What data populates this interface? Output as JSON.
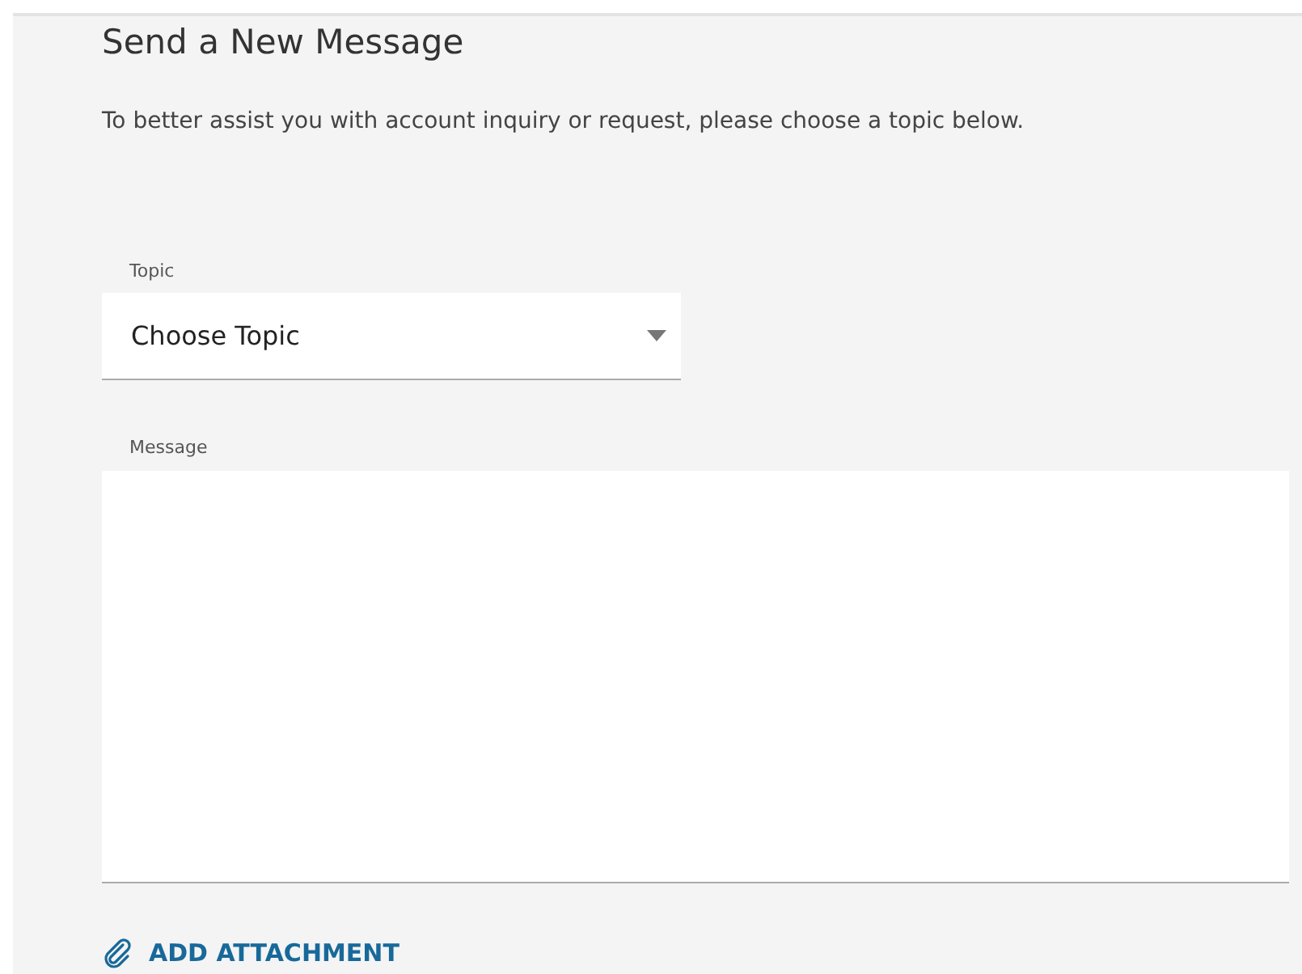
{
  "title": "Send a New Message",
  "description": "To better assist you with account inquiry or request, please choose a topic below.",
  "topic": {
    "label": "Topic",
    "placeholder": "Choose Topic"
  },
  "message": {
    "label": "Message"
  },
  "attachment": {
    "label": "ADD ATTACHMENT"
  }
}
